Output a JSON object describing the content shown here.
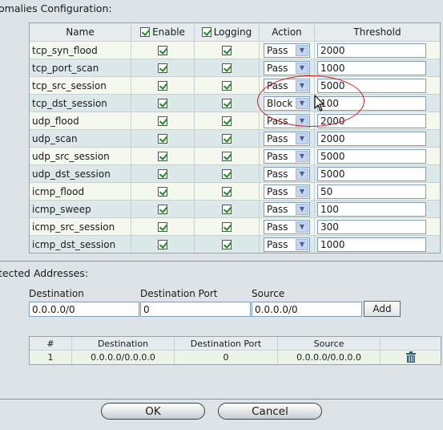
{
  "anomalies": {
    "section_title": "omalies Configuration:",
    "headers": {
      "name": "Name",
      "enable": "Enable",
      "logging": "Logging",
      "action": "Action",
      "threshold": "Threshold"
    },
    "rows": [
      {
        "name": "tcp_syn_flood",
        "enabled": true,
        "logging": true,
        "action": "Pass",
        "threshold": "2000"
      },
      {
        "name": "tcp_port_scan",
        "enabled": true,
        "logging": true,
        "action": "Pass",
        "threshold": "1000"
      },
      {
        "name": "tcp_src_session",
        "enabled": true,
        "logging": true,
        "action": "Pass",
        "threshold": "5000"
      },
      {
        "name": "tcp_dst_session",
        "enabled": true,
        "logging": true,
        "action": "Block",
        "threshold": "100"
      },
      {
        "name": "udp_flood",
        "enabled": true,
        "logging": true,
        "action": "Pass",
        "threshold": "2000"
      },
      {
        "name": "udp_scan",
        "enabled": true,
        "logging": true,
        "action": "Pass",
        "threshold": "2000"
      },
      {
        "name": "udp_src_session",
        "enabled": true,
        "logging": true,
        "action": "Pass",
        "threshold": "5000"
      },
      {
        "name": "udp_dst_session",
        "enabled": true,
        "logging": true,
        "action": "Pass",
        "threshold": "5000"
      },
      {
        "name": "icmp_flood",
        "enabled": true,
        "logging": true,
        "action": "Pass",
        "threshold": "50"
      },
      {
        "name": "icmp_sweep",
        "enabled": true,
        "logging": true,
        "action": "Pass",
        "threshold": "100"
      },
      {
        "name": "icmp_src_session",
        "enabled": true,
        "logging": true,
        "action": "Pass",
        "threshold": "300"
      },
      {
        "name": "icmp_dst_session",
        "enabled": true,
        "logging": true,
        "action": "Pass",
        "threshold": "1000"
      }
    ]
  },
  "protected": {
    "section_title": "tected Addresses:",
    "labels": {
      "destination": "Destination",
      "destination_port": "Destination Port",
      "source": "Source"
    },
    "inputs": {
      "destination": "0.0.0.0/0",
      "destination_port": "0",
      "source": "0.0.0.0/0"
    },
    "add_label": "Add",
    "table_headers": {
      "num": "#",
      "destination": "Destination",
      "destination_port": "Destination Port",
      "source": "Source"
    },
    "table_rows": [
      {
        "num": "1",
        "destination": "0.0.0.0/0.0.0.0",
        "destination_port": "0",
        "source": "0.0.0.0/0.0.0.0",
        "delete_icon": "trash-icon"
      }
    ]
  },
  "buttons": {
    "ok": "OK",
    "cancel": "Cancel"
  },
  "annotation": {
    "highlight_color": "#d21f1f"
  }
}
